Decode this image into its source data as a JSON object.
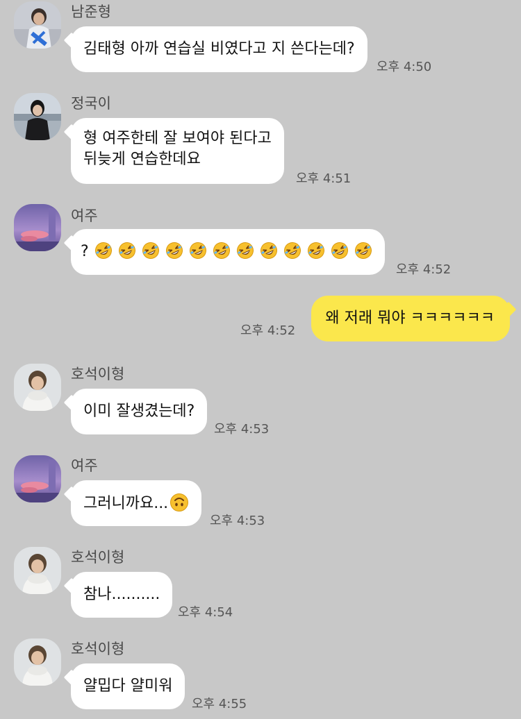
{
  "messages": [
    {
      "sender": "남준형",
      "avatar": "avatar-namjoon",
      "lines": [
        "김태형 아까 연습실 비였다고 지 쓴다는데?"
      ],
      "time": "오후 4:50"
    },
    {
      "sender": "정국이",
      "avatar": "avatar-jungkook",
      "lines": [
        "형 여주한테 잘 보여야 된다고",
        "뒤늦게 연습한데요"
      ],
      "time": "오후 4:51"
    },
    {
      "sender": "여주",
      "avatar": "avatar-yeoju",
      "prefix": "?",
      "emoji_count": 12,
      "emoji_name": "rolling-on-floor-laughing-emoji",
      "time": "오후 4:52"
    },
    {
      "mine": true,
      "text": "왜 저래 뭐야 ㅋㅋㅋㅋㅋㅋ",
      "time": "오후 4:52"
    },
    {
      "sender": "호석이형",
      "avatar": "avatar-hoseok",
      "lines": [
        "이미 잘생겼는데?"
      ],
      "time": "오후 4:53"
    },
    {
      "sender": "여주",
      "avatar": "avatar-yeoju",
      "text": "그러니까요...",
      "trailing_emoji": "upside-down-face-emoji",
      "time": "오후 4:53"
    },
    {
      "sender": "호석이형",
      "avatar": "avatar-hoseok",
      "lines": [
        "참나.........."
      ],
      "time": "오후 4:54"
    },
    {
      "sender": "호석이형",
      "avatar": "avatar-hoseok",
      "lines": [
        "얄밉다 얄미워"
      ],
      "time": "오후 4:55"
    }
  ],
  "colors": {
    "background": "#c8c8c8",
    "bubble_other": "#ffffff",
    "bubble_mine": "#fbe74c",
    "time": "#555555",
    "sender": "#4a4a4a"
  }
}
